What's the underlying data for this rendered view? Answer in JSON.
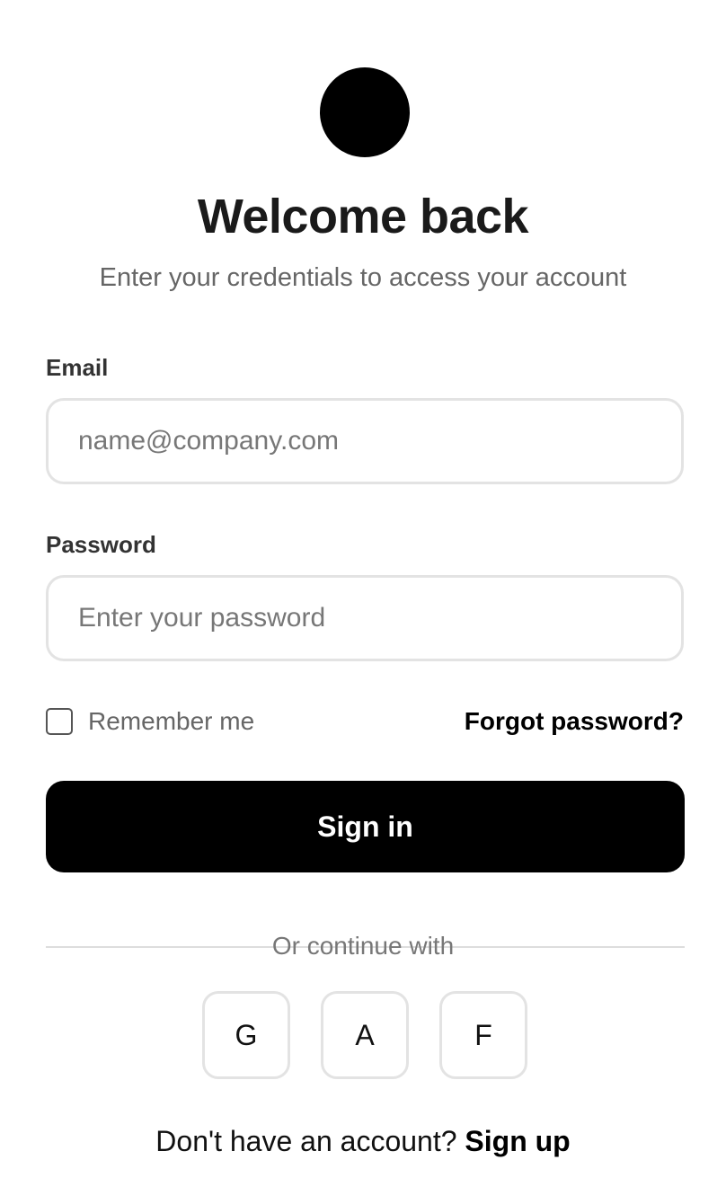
{
  "header": {
    "title": "Welcome back",
    "subtitle": "Enter your credentials to access your account"
  },
  "form": {
    "email_label": "Email",
    "email_placeholder": "name@company.com",
    "email_value": "",
    "password_label": "Password",
    "password_placeholder": "Enter your password",
    "password_value": "",
    "remember_label": "Remember me",
    "remember_checked": false,
    "forgot_label": "Forgot password?",
    "submit_label": "Sign in"
  },
  "social": {
    "divider_text": "Or continue with",
    "buttons": [
      "G",
      "A",
      "F"
    ]
  },
  "footer": {
    "prompt": "Don't have an account?",
    "link": "Sign up"
  },
  "colors": {
    "primary": "#000000",
    "border": "#e3e3e3",
    "muted_text": "#666666"
  }
}
